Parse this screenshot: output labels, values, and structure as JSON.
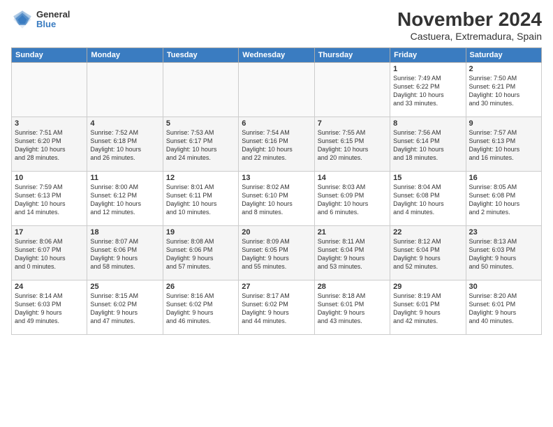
{
  "logo": {
    "general": "General",
    "blue": "Blue"
  },
  "header": {
    "month": "November 2024",
    "location": "Castuera, Extremadura, Spain"
  },
  "weekdays": [
    "Sunday",
    "Monday",
    "Tuesday",
    "Wednesday",
    "Thursday",
    "Friday",
    "Saturday"
  ],
  "rows": [
    [
      {
        "day": "",
        "info": ""
      },
      {
        "day": "",
        "info": ""
      },
      {
        "day": "",
        "info": ""
      },
      {
        "day": "",
        "info": ""
      },
      {
        "day": "",
        "info": ""
      },
      {
        "day": "1",
        "info": "Sunrise: 7:49 AM\nSunset: 6:22 PM\nDaylight: 10 hours\nand 33 minutes."
      },
      {
        "day": "2",
        "info": "Sunrise: 7:50 AM\nSunset: 6:21 PM\nDaylight: 10 hours\nand 30 minutes."
      }
    ],
    [
      {
        "day": "3",
        "info": "Sunrise: 7:51 AM\nSunset: 6:20 PM\nDaylight: 10 hours\nand 28 minutes."
      },
      {
        "day": "4",
        "info": "Sunrise: 7:52 AM\nSunset: 6:18 PM\nDaylight: 10 hours\nand 26 minutes."
      },
      {
        "day": "5",
        "info": "Sunrise: 7:53 AM\nSunset: 6:17 PM\nDaylight: 10 hours\nand 24 minutes."
      },
      {
        "day": "6",
        "info": "Sunrise: 7:54 AM\nSunset: 6:16 PM\nDaylight: 10 hours\nand 22 minutes."
      },
      {
        "day": "7",
        "info": "Sunrise: 7:55 AM\nSunset: 6:15 PM\nDaylight: 10 hours\nand 20 minutes."
      },
      {
        "day": "8",
        "info": "Sunrise: 7:56 AM\nSunset: 6:14 PM\nDaylight: 10 hours\nand 18 minutes."
      },
      {
        "day": "9",
        "info": "Sunrise: 7:57 AM\nSunset: 6:13 PM\nDaylight: 10 hours\nand 16 minutes."
      }
    ],
    [
      {
        "day": "10",
        "info": "Sunrise: 7:59 AM\nSunset: 6:13 PM\nDaylight: 10 hours\nand 14 minutes."
      },
      {
        "day": "11",
        "info": "Sunrise: 8:00 AM\nSunset: 6:12 PM\nDaylight: 10 hours\nand 12 minutes."
      },
      {
        "day": "12",
        "info": "Sunrise: 8:01 AM\nSunset: 6:11 PM\nDaylight: 10 hours\nand 10 minutes."
      },
      {
        "day": "13",
        "info": "Sunrise: 8:02 AM\nSunset: 6:10 PM\nDaylight: 10 hours\nand 8 minutes."
      },
      {
        "day": "14",
        "info": "Sunrise: 8:03 AM\nSunset: 6:09 PM\nDaylight: 10 hours\nand 6 minutes."
      },
      {
        "day": "15",
        "info": "Sunrise: 8:04 AM\nSunset: 6:08 PM\nDaylight: 10 hours\nand 4 minutes."
      },
      {
        "day": "16",
        "info": "Sunrise: 8:05 AM\nSunset: 6:08 PM\nDaylight: 10 hours\nand 2 minutes."
      }
    ],
    [
      {
        "day": "17",
        "info": "Sunrise: 8:06 AM\nSunset: 6:07 PM\nDaylight: 10 hours\nand 0 minutes."
      },
      {
        "day": "18",
        "info": "Sunrise: 8:07 AM\nSunset: 6:06 PM\nDaylight: 9 hours\nand 58 minutes."
      },
      {
        "day": "19",
        "info": "Sunrise: 8:08 AM\nSunset: 6:06 PM\nDaylight: 9 hours\nand 57 minutes."
      },
      {
        "day": "20",
        "info": "Sunrise: 8:09 AM\nSunset: 6:05 PM\nDaylight: 9 hours\nand 55 minutes."
      },
      {
        "day": "21",
        "info": "Sunrise: 8:11 AM\nSunset: 6:04 PM\nDaylight: 9 hours\nand 53 minutes."
      },
      {
        "day": "22",
        "info": "Sunrise: 8:12 AM\nSunset: 6:04 PM\nDaylight: 9 hours\nand 52 minutes."
      },
      {
        "day": "23",
        "info": "Sunrise: 8:13 AM\nSunset: 6:03 PM\nDaylight: 9 hours\nand 50 minutes."
      }
    ],
    [
      {
        "day": "24",
        "info": "Sunrise: 8:14 AM\nSunset: 6:03 PM\nDaylight: 9 hours\nand 49 minutes."
      },
      {
        "day": "25",
        "info": "Sunrise: 8:15 AM\nSunset: 6:02 PM\nDaylight: 9 hours\nand 47 minutes."
      },
      {
        "day": "26",
        "info": "Sunrise: 8:16 AM\nSunset: 6:02 PM\nDaylight: 9 hours\nand 46 minutes."
      },
      {
        "day": "27",
        "info": "Sunrise: 8:17 AM\nSunset: 6:02 PM\nDaylight: 9 hours\nand 44 minutes."
      },
      {
        "day": "28",
        "info": "Sunrise: 8:18 AM\nSunset: 6:01 PM\nDaylight: 9 hours\nand 43 minutes."
      },
      {
        "day": "29",
        "info": "Sunrise: 8:19 AM\nSunset: 6:01 PM\nDaylight: 9 hours\nand 42 minutes."
      },
      {
        "day": "30",
        "info": "Sunrise: 8:20 AM\nSunset: 6:01 PM\nDaylight: 9 hours\nand 40 minutes."
      }
    ]
  ]
}
